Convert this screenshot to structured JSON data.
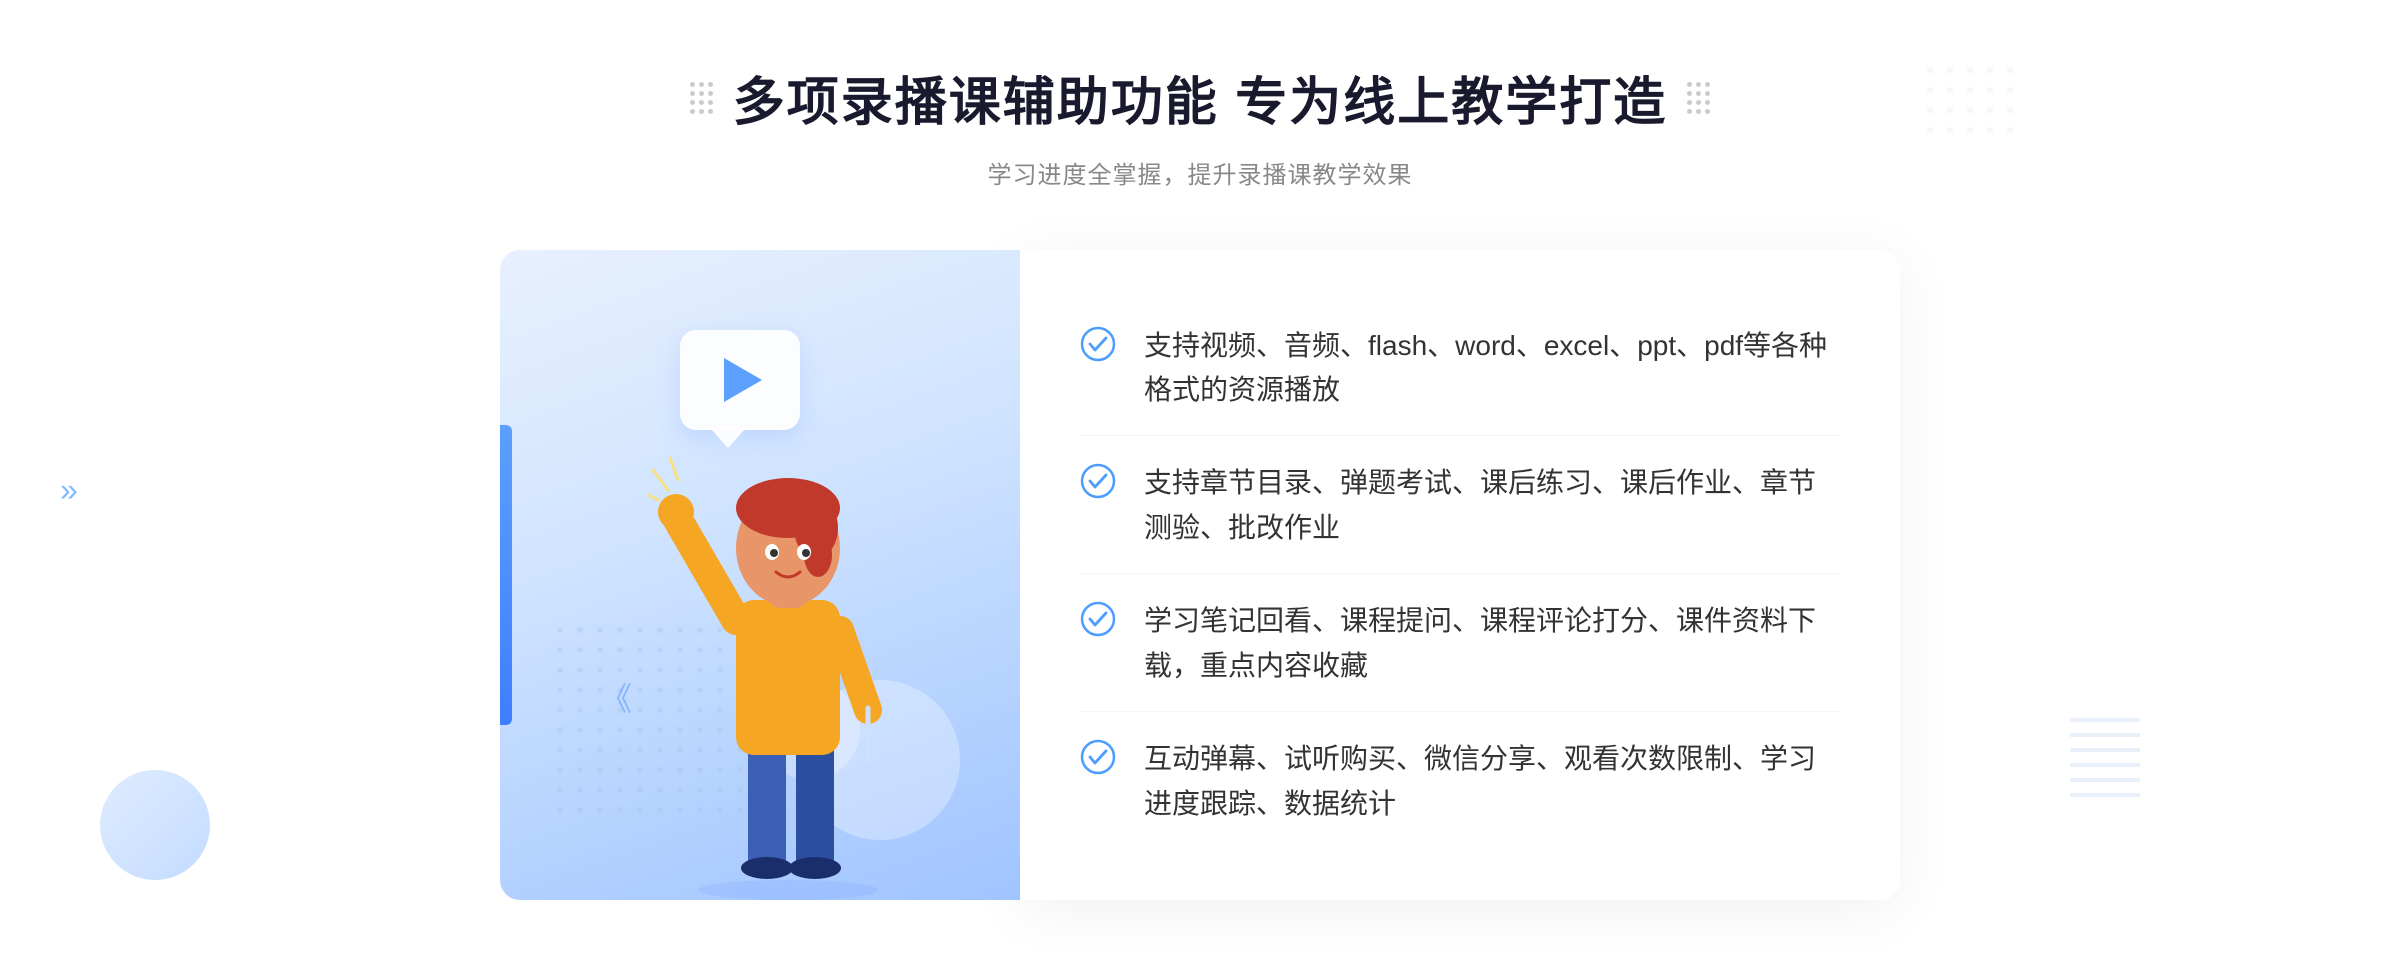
{
  "header": {
    "title": "多项录播课辅助功能 专为线上教学打造",
    "subtitle": "学习进度全掌握，提升录播课教学效果",
    "title_dots_aria": "decorative dots"
  },
  "features": [
    {
      "id": 1,
      "text": "支持视频、音频、flash、word、excel、ppt、pdf等各种格式的资源播放"
    },
    {
      "id": 2,
      "text": "支持章节目录、弹题考试、课后练习、课后作业、章节测验、批改作业"
    },
    {
      "id": 3,
      "text": "学习笔记回看、课程提问、课程评论打分、课件资料下载，重点内容收藏"
    },
    {
      "id": 4,
      "text": "互动弹幕、试听购买、微信分享、观看次数限制、学习进度跟踪、数据统计"
    }
  ],
  "illustration": {
    "play_label": "播放",
    "aria": "课程播放插图"
  },
  "colors": {
    "accent_blue": "#4d9dff",
    "dark_blue": "#3d7fff",
    "text_dark": "#1a1a2e",
    "text_gray": "#888888",
    "text_body": "#333333"
  }
}
